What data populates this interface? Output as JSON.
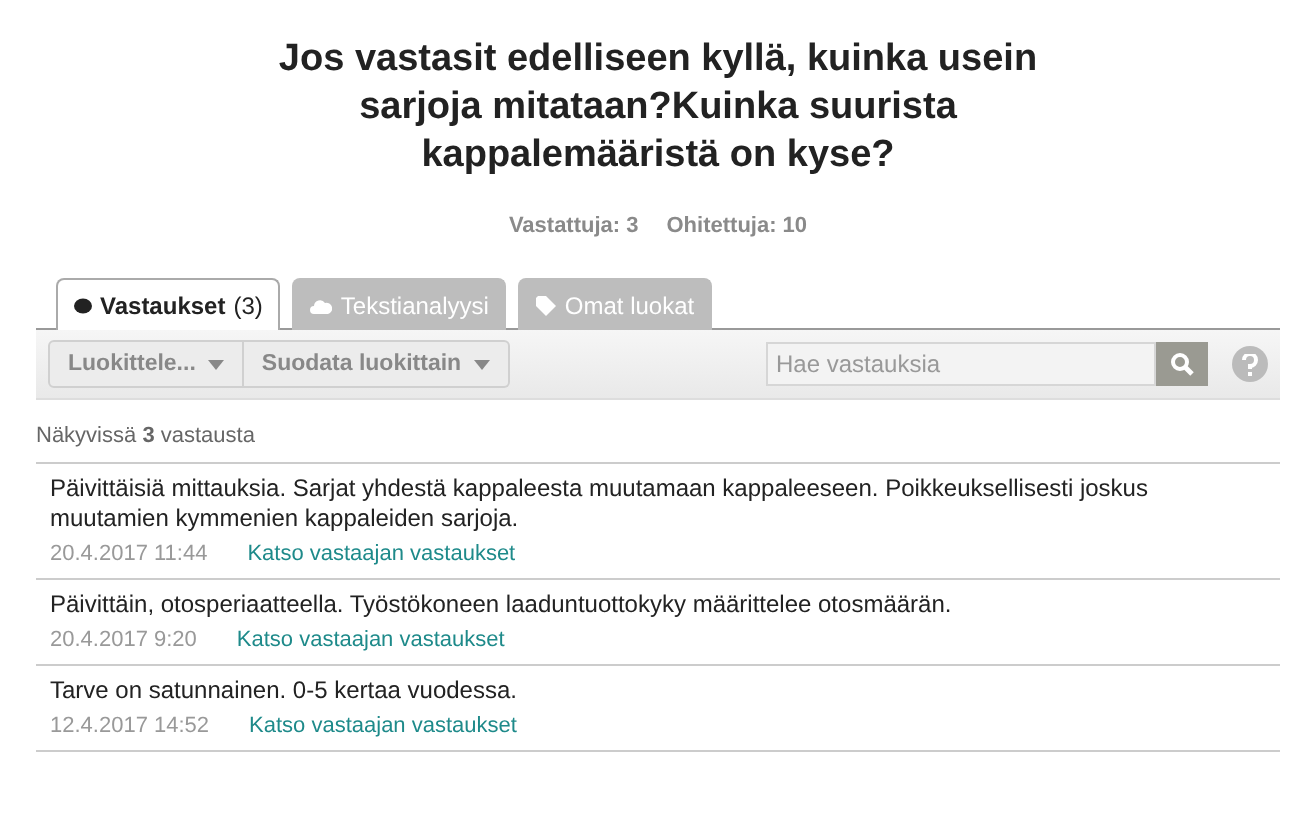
{
  "title": "Jos vastasit edelliseen kyllä, kuinka usein sarjoja mitataan?Kuinka suurista kappalemääristä on kyse?",
  "stats": [
    "Vastattuja: 3",
    "Ohitettuja: 10"
  ],
  "tabs": [
    {
      "label": "Vastaukset",
      "count": "(3)",
      "kind": "dot",
      "selected": true
    },
    {
      "label": "Tekstianalyysi",
      "kind": "cloud",
      "selected": false
    },
    {
      "label": "Omat luokat",
      "kind": "tag",
      "selected": false
    }
  ],
  "toolbar": {
    "buttons": [
      "Luokittele...",
      "Suodata luokittain"
    ],
    "search": {
      "placeholder": "Hae vastauksia"
    }
  },
  "visible_count": "Näkyvissä **3** vastausta",
  "answers": [
    {
      "text": "Päivittäisiä mittauksia. Sarjat yhdestä kappaleesta muutamaan kappaleeseen. Poikkeuksellisesti joskus muutamien kymmenien kappaleiden sarjoja.",
      "date": "20.4.2017 11:44",
      "link": "Katso vastaajan vastaukset"
    },
    {
      "text": "Päivittäin, otosperiaatteella. Työstökoneen laaduntuottokyky määrittelee otosmäärän.",
      "date": "20.4.2017 9:20",
      "link": "Katso vastaajan vastaukset"
    },
    {
      "text": "Tarve on satunnainen. 0-5 kertaa vuodessa.",
      "date": "12.4.2017 14:52",
      "link": "Katso vastaajan vastaukset"
    }
  ]
}
